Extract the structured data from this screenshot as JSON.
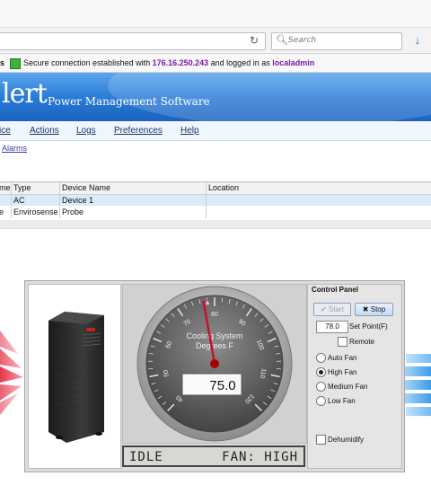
{
  "browser": {
    "search_placeholder": "Search",
    "reload_icon": "reload-icon",
    "download_icon": "download-icon"
  },
  "status": {
    "prefix_fragment": "s",
    "message_start": "Secure connection established with ",
    "ip": "176.16.250.243",
    "message_mid": " and logged in as ",
    "user": "localadmin"
  },
  "banner": {
    "brand_fragment": "lert",
    "subtitle": "Power Management Software"
  },
  "menu": {
    "items": [
      {
        "label": "ice"
      },
      {
        "label": "Actions"
      },
      {
        "label": "Logs"
      },
      {
        "label": "Preferences"
      },
      {
        "label": "Help"
      }
    ]
  },
  "breadcrumb": "Alarms",
  "table": {
    "headers": [
      "me",
      "Type",
      "Device Name",
      "Location"
    ],
    "rows": [
      [
        "",
        "AC",
        "Device 1",
        ""
      ],
      [
        "e",
        "Envirosense",
        "Probe",
        ""
      ]
    ]
  },
  "gauge": {
    "title_line1": "Cooling System",
    "title_line2": "Degrees F",
    "value": "75.0",
    "needle_value": 77,
    "setpoint_value": 78,
    "scale_min": 40,
    "scale_max": 120,
    "tick_labels": [
      "40",
      "50",
      "60",
      "70",
      "80",
      "90",
      "100",
      "110",
      "120"
    ]
  },
  "lcd": {
    "state": "IDLE",
    "fan": "FAN: HIGH"
  },
  "control_panel": {
    "title": "Control Panel",
    "start_label": "Start",
    "stop_label": "Stop",
    "setpoint_value": "78.0",
    "setpoint_label": "Set Point(F)",
    "remote_label": "Remote",
    "remote_checked": false,
    "fan_options": [
      {
        "label": "Auto Fan",
        "selected": false
      },
      {
        "label": "High Fan",
        "selected": true
      },
      {
        "label": "Medium Fan",
        "selected": false
      },
      {
        "label": "Low Fan",
        "selected": false
      }
    ],
    "dehumidify_label": "Dehumidify",
    "dehumidify_checked": false
  },
  "colors": {
    "banner": "#2a7cd8",
    "ip_text": "#7a1aa8",
    "selected_row": "#d8ebfb",
    "hot_flow": "#e8344a",
    "cold_flow": "#3a9de8"
  }
}
